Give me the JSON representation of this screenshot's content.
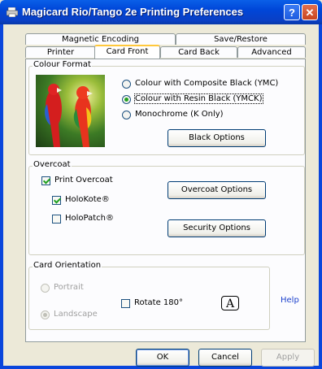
{
  "window": {
    "title": "Magicard Rio/Tango 2e Printing Preferences",
    "help_btn": "?",
    "close_btn": "✕"
  },
  "tabs": {
    "row_back": [
      "Magnetic Encoding",
      "Save/Restore"
    ],
    "row_front": [
      "Printer",
      "Card Front",
      "Card Back",
      "Advanced"
    ],
    "active": "Card Front"
  },
  "colour_format": {
    "legend": "Colour Format",
    "options": [
      "Colour with Composite Black (YMC)",
      "Colour with Resin Black (YMCK)",
      "Monochrome (K Only)"
    ],
    "selected_index": 1,
    "black_options_label": "Black Options"
  },
  "overcoat": {
    "legend": "Overcoat",
    "print_overcoat": {
      "label": "Print Overcoat",
      "checked": true
    },
    "holokote": {
      "label": "HoloKote®",
      "checked": true
    },
    "holopatch": {
      "label": "HoloPatch®",
      "checked": false
    },
    "overcoat_options_label": "Overcoat Options",
    "security_options_label": "Security Options"
  },
  "orientation": {
    "legend": "Card Orientation",
    "portrait": "Portrait",
    "landscape": "Landscape",
    "rotate": {
      "label": "Rotate 180°",
      "checked": false
    },
    "preview_letter": "A"
  },
  "help_link": "Help",
  "buttons": {
    "ok": "OK",
    "cancel": "Cancel",
    "apply": "Apply"
  },
  "colors": {
    "title_bar": "#0a46dc",
    "dialog_bg": "#ece9d8",
    "tab_highlight": "#ffc83c",
    "check_green": "#21a121"
  }
}
